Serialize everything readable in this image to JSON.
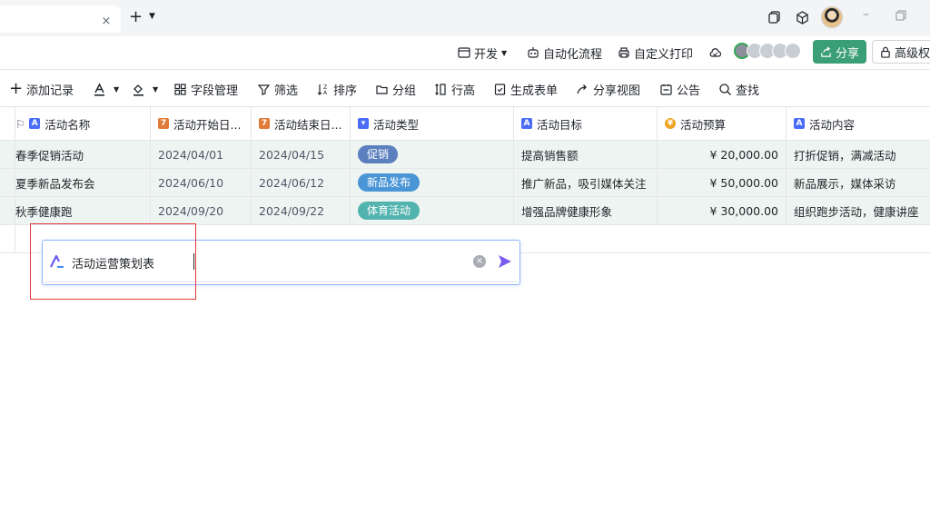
{
  "titlebar": {
    "new_tab_label": "+",
    "close_tab": "×",
    "minimize": "–"
  },
  "toolbar2": {
    "dev": "开发",
    "automation": "自动化流程",
    "custom_print": "自定义打印",
    "share": "分享",
    "advanced": "高级权"
  },
  "toolbar3": {
    "add_record": "添加记录",
    "field_manage": "字段管理",
    "filter": "筛选",
    "sort": "排序",
    "group": "分组",
    "row_height": "行高",
    "gen_form": "生成表单",
    "share_view": "分享视图",
    "notice": "公告",
    "search": "查找"
  },
  "table": {
    "headers": {
      "name": "活动名称",
      "start": "活动开始日...",
      "end": "活动结束日...",
      "type": "活动类型",
      "goal": "活动目标",
      "budget": "活动预算",
      "content": "活动内容"
    },
    "rows": [
      {
        "name": "春季促销活动",
        "start": "2024/04/01",
        "end": "2024/04/15",
        "type": "促销",
        "goal": "提高销售额",
        "budget": "¥ 20,000.00",
        "content": "打折促销，满减活动"
      },
      {
        "name": "夏季新品发布会",
        "start": "2024/06/10",
        "end": "2024/06/12",
        "type": "新品发布",
        "goal": "推广新品，吸引媒体关注",
        "budget": "¥ 50,000.00",
        "content": "新品展示，媒体采访"
      },
      {
        "name": "秋季健康跑",
        "start": "2024/09/20",
        "end": "2024/09/22",
        "type": "体育活动",
        "goal": "增强品牌健康形象",
        "budget": "¥ 30,000.00",
        "content": "组织跑步活动，健康讲座"
      }
    ]
  },
  "colors": {
    "tag_promo": "#5b7fbf",
    "tag_new": "#4a95d6",
    "tag_sport": "#53b3ae",
    "share_green": "#3a9e76",
    "row_bg": "#eef4f1",
    "highlight": "#e53935"
  },
  "ai_input": {
    "value": "活动运营策划表"
  }
}
